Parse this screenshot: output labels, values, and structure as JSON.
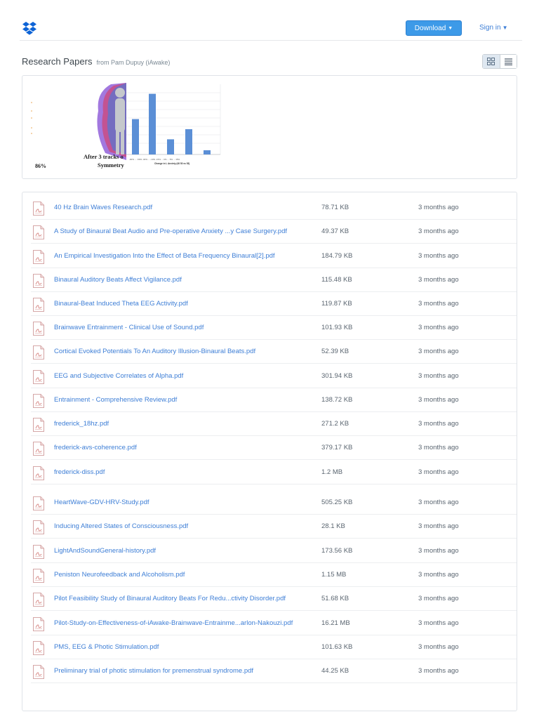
{
  "topbar": {
    "download_label": "Download",
    "signin_label": "Sign in"
  },
  "header": {
    "title": "Research Papers",
    "subtitle": "from Pam Dupuy (iAwake)"
  },
  "preview": {
    "left_caption_line1": "After 3 tracks o",
    "left_caption_line2": "Symmetry",
    "left_percent": "86%",
    "chart_xlabel": "Change in L Anxiety (48 53 vs 53)",
    "chart_values": [
      0.42,
      0.72,
      0.18,
      0.3,
      0.05
    ]
  },
  "files": [
    {
      "name": "40 Hz Brain Waves Research.pdf",
      "size": "78.71 KB",
      "date": "3 months ago"
    },
    {
      "name": "A Study of Binaural Beat Audio and Pre-operative Anxiety ...y Case Surgery.pdf",
      "size": "49.37 KB",
      "date": "3 months ago"
    },
    {
      "name": "An Empirical Investigation Into the Effect of Beta Frequency Binaural[2].pdf",
      "size": "184.79 KB",
      "date": "3 months ago"
    },
    {
      "name": "Binaural Auditory Beats Affect Vigilance.pdf",
      "size": "115.48 KB",
      "date": "3 months ago"
    },
    {
      "name": "Binaural-Beat Induced Theta EEG Activity.pdf",
      "size": "119.87 KB",
      "date": "3 months ago"
    },
    {
      "name": "Brainwave Entrainment - Clinical Use of Sound.pdf",
      "size": "101.93 KB",
      "date": "3 months ago"
    },
    {
      "name": "Cortical Evoked Potentials To An Auditory Illusion-Binaural Beats.pdf",
      "size": "52.39 KB",
      "date": "3 months ago"
    },
    {
      "name": "EEG and Subjective Correlates of Alpha.pdf",
      "size": "301.94 KB",
      "date": "3 months ago"
    },
    {
      "name": "Entrainment - Comprehensive Review.pdf",
      "size": "138.72 KB",
      "date": "3 months ago"
    },
    {
      "name": "frederick_18hz.pdf",
      "size": "271.2 KB",
      "date": "3 months ago"
    },
    {
      "name": "frederick-avs-coherence.pdf",
      "size": "379.17 KB",
      "date": "3 months ago"
    },
    {
      "name": "frederick-diss.pdf",
      "size": "1.2 MB",
      "date": "3 months ago"
    },
    {
      "name": "HeartWave-GDV-HRV-Study.pdf",
      "size": "505.25 KB",
      "date": "3 months ago"
    },
    {
      "name": "Inducing Altered States of Consciousness.pdf",
      "size": "28.1 KB",
      "date": "3 months ago"
    },
    {
      "name": "LightAndSoundGeneral-history.pdf",
      "size": "173.56 KB",
      "date": "3 months ago"
    },
    {
      "name": "Peniston Neurofeedback and Alcoholism.pdf",
      "size": "1.15 MB",
      "date": "3 months ago"
    },
    {
      "name": "Pilot Feasibility Study of Binaural Auditory Beats For Redu...ctivity Disorder.pdf",
      "size": "51.68 KB",
      "date": "3 months ago"
    },
    {
      "name": "Pilot-Study-on-Effectiveness-of-iAwake-Brainwave-Entrainme...arlon-Nakouzi.pdf",
      "size": "16.21 MB",
      "date": "3 months ago"
    },
    {
      "name": "PMS, EEG & Photic Stimulation.pdf",
      "size": "101.63 KB",
      "date": "3 months ago"
    },
    {
      "name": "Preliminary trial of photic stimulation for premenstrual syndrome.pdf",
      "size": "44.25 KB",
      "date": "3 months ago"
    }
  ]
}
